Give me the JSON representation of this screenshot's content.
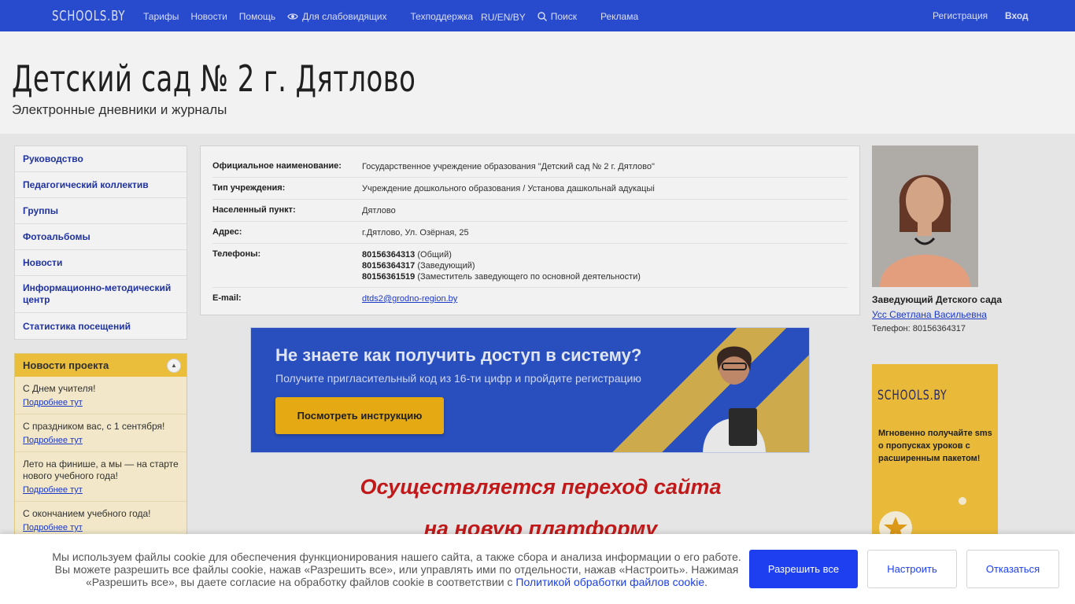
{
  "nav": {
    "logo": "SCHOOLS.BY",
    "links": [
      "Тарифы",
      "Новости",
      "Помощь",
      "Для слабовидящих",
      "Техподдержка",
      "RU/EN/BY",
      "Поиск",
      "Реклама"
    ],
    "register": "Регистрация",
    "login": "Вход"
  },
  "header": {
    "title": "Детский сад № 2 г. Дятлово",
    "subtitle": "Электронные дневники и журналы"
  },
  "sidebar": {
    "items": [
      "Руководство",
      "Педагогический коллектив",
      "Группы",
      "Фотоальбомы",
      "Новости",
      "Информационно-методический центр",
      "Статистика посещений"
    ]
  },
  "news": {
    "title": "Новости проекта",
    "more_label": "Подробнее тут",
    "items": [
      "С Днем учителя!",
      "С праздником вас, с 1 сентября!",
      "Лето на финише, а мы — на старте нового учебного года!",
      "С окончанием учебного года!"
    ]
  },
  "info": {
    "official_name_label": "Официальное наименование:",
    "official_name": "Государственное учреждение образования \"Детский сад № 2 г. Дятлово\"",
    "type_label": "Тип учреждения:",
    "type": "Учреждение дошкольного образования / Установа дашкольнай адукацыі",
    "locality_label": "Населенный пункт:",
    "locality": "Дятлово",
    "address_label": "Адрес:",
    "address": "г.Дятлово, Ул. Озёрная, 25",
    "phones_label": "Телефоны:",
    "phones": [
      {
        "number": "80156364313",
        "note": " (Общий)"
      },
      {
        "number": "80156364317",
        "note": " (Заведующий)"
      },
      {
        "number": "80156361519",
        "note": " (Заместитель заведующего по основной деятельности)"
      }
    ],
    "email_label": "E-mail:",
    "email": "dtds2@grodno-region.by"
  },
  "banner": {
    "title": "Не знаете как получить доступ в систему?",
    "subtitle": "Получите пригласительный код из 16-ти цифр и пройдите регистрацию",
    "button": "Посмотреть инструкцию"
  },
  "transition": {
    "line1": "Осуществляется переход сайта",
    "line2": "на новую платформу"
  },
  "director": {
    "role": "Заведующий Детского сада",
    "name": "Усс Светлана Васильевна",
    "phone": "Телефон: 80156364317"
  },
  "sms_ad": {
    "logo": "SCHOOLS.BY",
    "text": "Мгновенно получайте sms о пропусках уроков с расширенным пакетом!"
  },
  "cookie": {
    "text": "Мы используем файлы cookie для обеспечения функционирования нашего сайта, а также сбора и анализа информации о его работе. Вы можете разрешить все файлы cookie, нажав «Разрешить все», или управлять ими по отдельности, нажав «Настроить». Нажимая «Разрешить все», вы даете согласие на обработку файлов cookie в соответствии с ",
    "link": "Политикой обработки файлов cookie",
    "end": ".",
    "accept": "Разрешить все",
    "configure": "Настроить",
    "decline": "Отказаться"
  },
  "colors": {
    "nav_bg": "#2b4fd8",
    "accent_link": "#1e3bd1",
    "news_header": "#f7c93f",
    "transition_text": "#cc1b1b",
    "cookie_primary": "#1d3ff0"
  }
}
